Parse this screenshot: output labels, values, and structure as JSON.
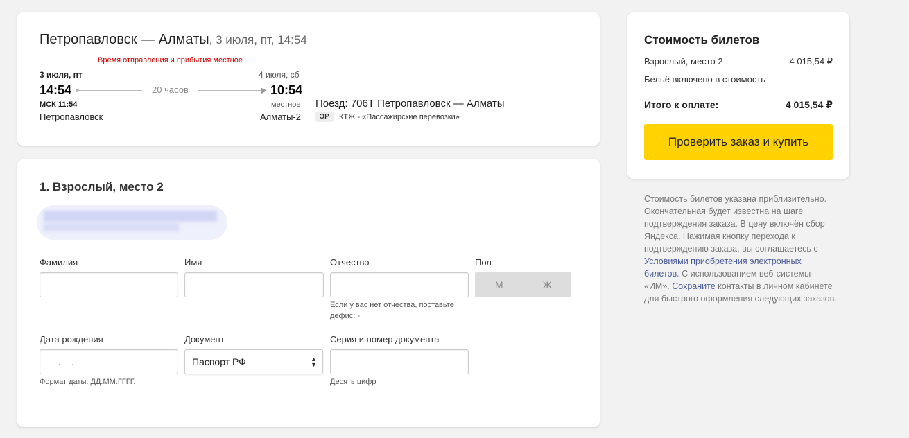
{
  "trip": {
    "route": "Петропавловск — Алматы",
    "datetime": ", 3 июля, пт, 14:54",
    "local_note": "Время отправления и прибытия местное",
    "departure": {
      "date": "3 июля, пт",
      "time": "14:54",
      "msk": "МСК 11:54",
      "station": "Петропавловск"
    },
    "arrival": {
      "date": "4 июля, сб",
      "time": "10:54",
      "tz_label": "местное",
      "station": "Алматы-2"
    },
    "duration": "20 часов",
    "train": "Поезд: 706Т Петропавловск — Алматы",
    "badge": "ЭР",
    "carrier": "КТЖ - «Пассажирские перевозки»"
  },
  "passenger": {
    "heading": "1. Взрослый, место 2",
    "fields": {
      "last_name": {
        "label": "Фамилия",
        "value": ""
      },
      "first_name": {
        "label": "Имя",
        "value": ""
      },
      "patronymic": {
        "label": "Отчество",
        "value": "",
        "hint": "Если у вас нет отчества, поставьте дефис: -"
      },
      "gender": {
        "label": "Пол",
        "options": [
          "М",
          "Ж"
        ]
      },
      "birth_date": {
        "label": "Дата рождения",
        "placeholder": "__.__.____",
        "hint": "Формат даты: ДД.ММ.ГГГГ."
      },
      "document": {
        "label": "Документ",
        "value": "Паспорт РФ"
      },
      "doc_number": {
        "label": "Серия и номер документа",
        "placeholder": "____ ______",
        "hint": "Десять цифр"
      }
    }
  },
  "price": {
    "title": "Стоимость билетов",
    "adult_label": "Взрослый, место 2",
    "adult_value": "4 015,54 ₽",
    "linen_note": "Бельё включено в стоимость",
    "total_label": "Итого к оплате:",
    "total_value": "4 015,54 ₽",
    "buy_label": "Проверить заказ и купить"
  },
  "disclaimer": {
    "text1": "Стоимость билетов указана приблизительно. Окончательная будет известна на шаге подтверждения заказа. В цену включён сбор Яндекса. Нажимая кнопку перехода к подтверждению заказа, вы соглашаетесь с ",
    "link1": "Условиями приобретения электронных билетов",
    "text2": ". С использованием веб-системы «ИМ». ",
    "link2": "Сохраните",
    "text3": " контакты в личном кабинете для быстрого оформления следующих заказов."
  },
  "colors": {
    "accent_yellow": "#ffd200",
    "link": "#4b5b9a",
    "note_red": "#cc0000"
  }
}
